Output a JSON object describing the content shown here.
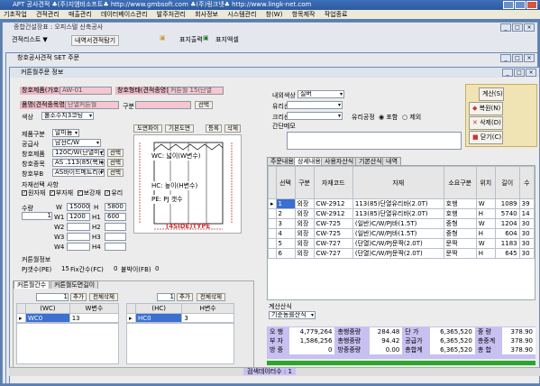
{
  "app": {
    "title": "APT 공사견적 ♣(주)지엠비소프트♣ http://www.gmbsoft.com ♣(주)링크넷♣ http://www.lingk-net.com"
  },
  "menu": [
    "기초작업",
    "견적관리",
    "매출관리",
    "데이터베이스관리",
    "발주처관리",
    "회사정보",
    "시스템관리",
    "창(W)",
    "항목제작",
    "작업종료"
  ],
  "win1": {
    "title": "종합건설장표 : 오피스텔 신축공사",
    "list_button": "견적리스트 ▼",
    "compare_button": "내역서견적탐기",
    "print_button": "표지출력",
    "excel_button": "표지엑셀"
  },
  "win2": {
    "title": "창호공사견적 SET 주문"
  },
  "win3": {
    "title": "커튼월주문 정보"
  },
  "form": {
    "lbl_code": "창호제품(가호)",
    "code": "AW-01",
    "lbl_shape": "창호형태(견적종명)",
    "shape": "커튼월 15(단열",
    "lbl_name": "품명(견적종목명)",
    "name": "단열커튼월",
    "lbl_type": "구분",
    "select_btn": "선택",
    "lbl_color": "색상",
    "color": "불소수지3코팅"
  },
  "spec": [
    {
      "label": "제품구분",
      "value": "알미늄"
    },
    {
      "label": "공급사",
      "value": "남선C/W"
    },
    {
      "label": "창호제품",
      "value": "120C/W(단열미관)",
      "btn": "선택"
    },
    {
      "label": "창호종목",
      "value": "AS .113(85(복)유리)",
      "btn": "선택"
    },
    {
      "label": "창호부B",
      "value": "AS바이드메트리(PJ",
      "btn": "선택"
    }
  ],
  "material": {
    "title": "자재선택 사항",
    "items": [
      "원자재",
      "부자재",
      "보강재",
      "유리"
    ]
  },
  "dims": {
    "label": "수량",
    "qty_w": "1",
    "qty": "1",
    "w_label": "W",
    "w_value": "15000",
    "h_label": "H",
    "h_value": "5800",
    "rows": [
      {
        "l": "W1",
        "v": "1200",
        "hl": "H1",
        "hv": "600"
      },
      {
        "l": "W2",
        "v": "",
        "hl": "H2",
        "hv": ""
      },
      {
        "l": "W3",
        "v": "",
        "hl": "H3",
        "hv": ""
      },
      {
        "l": "W4",
        "v": "",
        "hl": "H4",
        "hv": ""
      }
    ]
  },
  "curtain": {
    "title": "커튼월정보",
    "pj": "PJ갯수(PE)",
    "pj_val": "15",
    "fix": "Fix간수(FC)",
    "fix_val": "0",
    "fb": "붙박이(FB)",
    "fb_val": "0"
  },
  "drawing": {
    "btn1": "도면파이",
    "btn2": "기본도면",
    "btn3": "등록",
    "btn4": "삭제",
    "wc": "WC: 넓이(W변수)",
    "hc": "HC: 높이(H변수)",
    "pe": "PE: PJ 갯수",
    "caption": "(4SIDE)TYPE"
  },
  "wc_panel": {
    "tab1": "커튼월간수",
    "tab2": "커튼월도면길이",
    "count": "1",
    "add": "추가",
    "del": "전체삭제",
    "col1": "(WC)",
    "col2": "W변수",
    "row_code": "WC0",
    "row_val": "13"
  },
  "hc_panel": {
    "count": "1",
    "add": "추가",
    "del": "전체삭제",
    "col1": "(HC)",
    "col2": "H변수",
    "row_code": "HC0",
    "row_val": "3"
  },
  "right_top": {
    "lbl1": "내외색상",
    "val1": "실버",
    "lbl2": "유리선택",
    "lbl3": "크리센트",
    "lbl4": "간단메모",
    "glass_label": "유리공정",
    "radio1": "포함",
    "radio2": "제외"
  },
  "actions": {
    "calc": "계산(S)",
    "copy": "복원(N)",
    "delete": "삭제(D)",
    "close": "닫기(C)"
  },
  "tabs": [
    "주문내용",
    "상세내용",
    "사용자산식",
    "기본산식",
    "내역"
  ],
  "table": {
    "headers": [
      "선택",
      "구분",
      "자재코드",
      "자재",
      "소요구분",
      "위치",
      "길이",
      "수"
    ],
    "rows": [
      [
        "1",
        "외장",
        "CW-2912",
        "113(85)단열유리바(2.0T)",
        "호행",
        "W",
        "1089",
        "39"
      ],
      [
        "2",
        "외장",
        "CW-2912",
        "113(85)단열유리바(2.0T)",
        "호행",
        "H",
        "5740",
        "14"
      ],
      [
        "3",
        "외장",
        "CW-725",
        "(일반)C/W/PJ바(1.5T)",
        "중형",
        "W",
        "1204",
        "30"
      ],
      [
        "4",
        "외장",
        "CW-725",
        "(일반)C/W/PJ바(1.5T)",
        "중형",
        "H",
        "604",
        "30"
      ],
      [
        "5",
        "외장",
        "CW-727",
        "(단열)C/W/PJ문짝(2.0T)",
        "문짝",
        "W",
        "1183",
        "30"
      ],
      [
        "6",
        "외장",
        "CW-727",
        "(단열)C/W/PJ문짝(2.0T)",
        "문짝",
        "H",
        "645",
        "30"
      ]
    ]
  },
  "calc_section": {
    "title": "계산산식",
    "value": "기준동를산식"
  },
  "summary": {
    "rows": [
      [
        "오 행",
        "4,779,264",
        "총행중량",
        "284.48",
        "단 가",
        "6,365,520",
        "중 량",
        "378.90"
      ],
      [
        "부 자",
        "1,586,256",
        "총행중량",
        "94.42",
        "공급가",
        "6,365,520",
        "총중계",
        "378.90"
      ],
      [
        "방 중",
        "0",
        "방중중량",
        "0.00",
        "총합계",
        "6,365,520",
        "총 합",
        "378.90"
      ]
    ]
  },
  "status": "검색데이터수 : 1"
}
